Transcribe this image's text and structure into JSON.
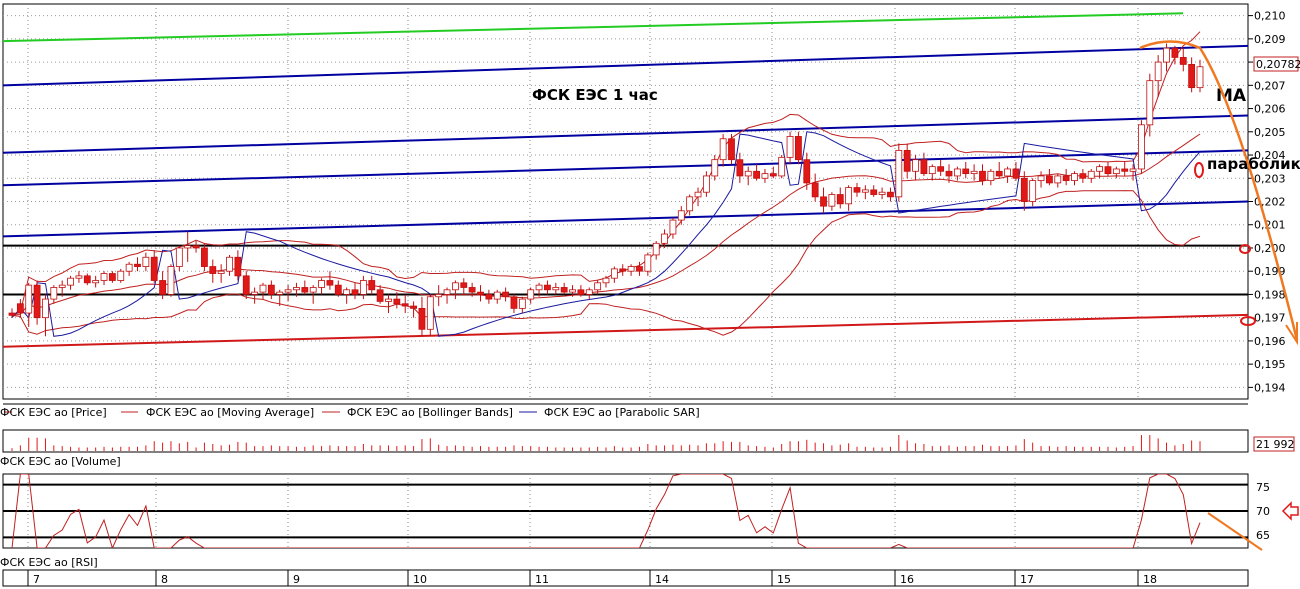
{
  "annotations": {
    "title": "ФСК ЕЭС   1 час",
    "ma": "MA",
    "parabolic": "параболик"
  },
  "price_panel": {
    "legend": [
      {
        "label": "ФСК ЕЭС ао [Price]",
        "color": "#e02020"
      },
      {
        "label": "ФСК ЕЭС ао [Moving Average]",
        "color": "#c02020"
      },
      {
        "label": "ФСК ЕЭС ао [Bollinger Bands]",
        "color": "#c02020"
      },
      {
        "label": "ФСК ЕЭС ао [Parabolic SAR]",
        "color": "#1a1aa0"
      }
    ],
    "yticks": [
      "0,210",
      "0,209",
      "0,208",
      "0,207",
      "0,206",
      "0,205",
      "0,204",
      "0,203",
      "0,202",
      "0,201",
      "0,200",
      "0,199",
      "0,198",
      "0,197",
      "0,196",
      "0,195",
      "0,194"
    ],
    "last_price": "0,20782"
  },
  "volume_panel": {
    "label": "ФСК ЕЭС ао [Volume]",
    "last_value": "21 992"
  },
  "rsi_panel": {
    "label": "ФСК ЕЭС ао [RSI]",
    "yticks": [
      "75",
      "70",
      "65"
    ]
  },
  "xaxis": {
    "labels": [
      "7",
      "8",
      "9",
      "10",
      "11",
      "14",
      "15",
      "16",
      "17",
      "18"
    ]
  },
  "colors": {
    "bullish": "#ffffff",
    "bearish": "#e01818",
    "candle_edge": "#c01010",
    "trend_blue": "#0000a0",
    "trend_green": "#22cc22",
    "trend_red": "#d01818",
    "level_black": "#000000",
    "forecast_orange": "#f07820"
  },
  "chart_data": {
    "type": "candlestick",
    "timeframe": "1h",
    "x_days": [
      "7",
      "8",
      "9",
      "10",
      "11",
      "14",
      "15",
      "16",
      "17",
      "18"
    ],
    "ylim": [
      0.1935,
      0.2105
    ],
    "candles_ohlc": [
      [
        0.1972,
        0.1974,
        0.197,
        0.1971
      ],
      [
        0.1976,
        0.1978,
        0.197,
        0.1972
      ],
      [
        0.1972,
        0.1985,
        0.1966,
        0.1984
      ],
      [
        0.1984,
        0.1986,
        0.1967,
        0.197
      ],
      [
        0.197,
        0.198,
        0.1962,
        0.1978
      ],
      [
        0.1978,
        0.1984,
        0.1976,
        0.1983
      ],
      [
        0.1983,
        0.1986,
        0.1979,
        0.1984
      ],
      [
        0.1984,
        0.1988,
        0.1982,
        0.1987
      ],
      [
        0.1987,
        0.199,
        0.1985,
        0.1988
      ],
      [
        0.1988,
        0.1989,
        0.1984,
        0.1985
      ],
      [
        0.1985,
        0.1988,
        0.1983,
        0.1986
      ],
      [
        0.1986,
        0.199,
        0.1984,
        0.1989
      ],
      [
        0.1989,
        0.199,
        0.1985,
        0.1986
      ],
      [
        0.1986,
        0.1991,
        0.1985,
        0.199
      ],
      [
        0.199,
        0.1994,
        0.1988,
        0.1993
      ],
      [
        0.1993,
        0.1996,
        0.199,
        0.1992
      ],
      [
        0.1992,
        0.1998,
        0.199,
        0.1996
      ],
      [
        0.1996,
        0.1999,
        0.1985,
        0.1986
      ],
      [
        0.1986,
        0.199,
        0.1978,
        0.198
      ],
      [
        0.198,
        0.1993,
        0.1979,
        0.1992
      ],
      [
        0.1992,
        0.2001,
        0.199,
        0.2
      ],
      [
        0.2,
        0.2007,
        0.1994,
        0.2001
      ],
      [
        0.2001,
        0.2003,
        0.1998,
        0.2
      ],
      [
        0.2,
        0.2002,
        0.199,
        0.1992
      ],
      [
        0.1992,
        0.1995,
        0.1985,
        0.1989
      ],
      [
        0.1989,
        0.1993,
        0.1985,
        0.199
      ],
      [
        0.199,
        0.1997,
        0.1988,
        0.1996
      ],
      [
        0.1996,
        0.1999,
        0.1986,
        0.1988
      ],
      [
        0.1988,
        0.199,
        0.1978,
        0.198
      ],
      [
        0.198,
        0.1983,
        0.1976,
        0.1981
      ],
      [
        0.1981,
        0.1985,
        0.1978,
        0.1984
      ],
      [
        0.1984,
        0.1986,
        0.1978,
        0.198
      ],
      [
        0.198,
        0.1982,
        0.1975,
        0.1981
      ],
      [
        0.1981,
        0.1984,
        0.1977,
        0.1982
      ],
      [
        0.1982,
        0.1985,
        0.1979,
        0.1983
      ],
      [
        0.1983,
        0.1986,
        0.198,
        0.1981
      ],
      [
        0.1981,
        0.1984,
        0.1976,
        0.1983
      ],
      [
        0.1983,
        0.1987,
        0.198,
        0.1986
      ],
      [
        0.1986,
        0.199,
        0.1982,
        0.1984
      ],
      [
        0.1984,
        0.1986,
        0.1979,
        0.198
      ],
      [
        0.198,
        0.1983,
        0.1976,
        0.1982
      ],
      [
        0.1982,
        0.1985,
        0.1978,
        0.198
      ],
      [
        0.198,
        0.1988,
        0.1978,
        0.1986
      ],
      [
        0.1986,
        0.1988,
        0.198,
        0.1982
      ],
      [
        0.1982,
        0.1984,
        0.1976,
        0.1977
      ],
      [
        0.1977,
        0.198,
        0.1972,
        0.1978
      ],
      [
        0.1978,
        0.1981,
        0.1974,
        0.1976
      ],
      [
        0.1976,
        0.198,
        0.1972,
        0.1975
      ],
      [
        0.1975,
        0.1977,
        0.197,
        0.1974
      ],
      [
        0.1974,
        0.1979,
        0.1962,
        0.1965
      ],
      [
        0.1965,
        0.198,
        0.1962,
        0.1979
      ],
      [
        0.1979,
        0.1984,
        0.1975,
        0.198
      ],
      [
        0.198,
        0.1983,
        0.1976,
        0.1982
      ],
      [
        0.1982,
        0.1986,
        0.1978,
        0.1985
      ],
      [
        0.1985,
        0.1987,
        0.198,
        0.1983
      ],
      [
        0.1983,
        0.1985,
        0.1979,
        0.1981
      ],
      [
        0.1981,
        0.1984,
        0.1977,
        0.198
      ],
      [
        0.198,
        0.1982,
        0.1976,
        0.1978
      ],
      [
        0.1978,
        0.1982,
        0.1976,
        0.1981
      ],
      [
        0.1981,
        0.1983,
        0.1977,
        0.1979
      ],
      [
        0.1979,
        0.198,
        0.1972,
        0.1974
      ],
      [
        0.1974,
        0.1979,
        0.1972,
        0.1978
      ],
      [
        0.1978,
        0.1983,
        0.1976,
        0.1982
      ],
      [
        0.1982,
        0.1985,
        0.1979,
        0.1984
      ],
      [
        0.1984,
        0.1986,
        0.198,
        0.1982
      ],
      [
        0.1982,
        0.1985,
        0.198,
        0.1983
      ],
      [
        0.1983,
        0.1985,
        0.198,
        0.1981
      ],
      [
        0.1981,
        0.1984,
        0.1979,
        0.1982
      ],
      [
        0.1982,
        0.1984,
        0.1979,
        0.198
      ],
      [
        0.198,
        0.1983,
        0.1978,
        0.1982
      ],
      [
        0.1982,
        0.1986,
        0.198,
        0.1985
      ],
      [
        0.1985,
        0.1988,
        0.1983,
        0.1987
      ],
      [
        0.1987,
        0.1992,
        0.1985,
        0.1991
      ],
      [
        0.1991,
        0.1993,
        0.1988,
        0.199
      ],
      [
        0.199,
        0.1993,
        0.1988,
        0.1992
      ],
      [
        0.1992,
        0.1994,
        0.1988,
        0.199
      ],
      [
        0.199,
        0.1998,
        0.1988,
        0.1997
      ],
      [
        0.1997,
        0.2003,
        0.1995,
        0.2002
      ],
      [
        0.2002,
        0.2008,
        0.2,
        0.2006
      ],
      [
        0.2006,
        0.2013,
        0.2004,
        0.2012
      ],
      [
        0.2012,
        0.2018,
        0.201,
        0.2016
      ],
      [
        0.2016,
        0.2023,
        0.2014,
        0.2022
      ],
      [
        0.2022,
        0.2026,
        0.2018,
        0.2024
      ],
      [
        0.2024,
        0.2033,
        0.2022,
        0.2031
      ],
      [
        0.2031,
        0.204,
        0.2029,
        0.2038
      ],
      [
        0.2038,
        0.2049,
        0.2035,
        0.2047
      ],
      [
        0.2047,
        0.2049,
        0.2036,
        0.2038
      ],
      [
        0.2038,
        0.2041,
        0.2028,
        0.2031
      ],
      [
        0.2031,
        0.2035,
        0.2027,
        0.2033
      ],
      [
        0.2033,
        0.2036,
        0.2029,
        0.203
      ],
      [
        0.203,
        0.2034,
        0.2028,
        0.2032
      ],
      [
        0.2032,
        0.2035,
        0.203,
        0.2031
      ],
      [
        0.2031,
        0.204,
        0.203,
        0.2039
      ],
      [
        0.2039,
        0.205,
        0.2036,
        0.2048
      ],
      [
        0.2048,
        0.205,
        0.2036,
        0.2038
      ],
      [
        0.2038,
        0.2041,
        0.2025,
        0.2028
      ],
      [
        0.2028,
        0.2032,
        0.202,
        0.2022
      ],
      [
        0.2022,
        0.2026,
        0.2015,
        0.2018
      ],
      [
        0.2018,
        0.2024,
        0.2016,
        0.2023
      ],
      [
        0.2023,
        0.2026,
        0.2017,
        0.2019
      ],
      [
        0.2019,
        0.2027,
        0.2016,
        0.2026
      ],
      [
        0.2026,
        0.2028,
        0.2022,
        0.2024
      ],
      [
        0.2024,
        0.2027,
        0.2021,
        0.2025
      ],
      [
        0.2025,
        0.2027,
        0.2022,
        0.2023
      ],
      [
        0.2023,
        0.2026,
        0.2021,
        0.2024
      ],
      [
        0.2024,
        0.2026,
        0.202,
        0.2022
      ],
      [
        0.2022,
        0.2045,
        0.202,
        0.2042
      ],
      [
        0.2042,
        0.2045,
        0.203,
        0.2033
      ],
      [
        0.2033,
        0.204,
        0.2029,
        0.2038
      ],
      [
        0.2038,
        0.2041,
        0.2031,
        0.2032
      ],
      [
        0.2032,
        0.2036,
        0.2029,
        0.2035
      ],
      [
        0.2035,
        0.2038,
        0.2031,
        0.2033
      ],
      [
        0.2033,
        0.2036,
        0.2028,
        0.2031
      ],
      [
        0.2031,
        0.2035,
        0.2029,
        0.2034
      ],
      [
        0.2034,
        0.2037,
        0.203,
        0.2032
      ],
      [
        0.2032,
        0.2036,
        0.2029,
        0.2033
      ],
      [
        0.2033,
        0.2036,
        0.2027,
        0.2029
      ],
      [
        0.2029,
        0.2034,
        0.2027,
        0.2033
      ],
      [
        0.2033,
        0.2037,
        0.203,
        0.2031
      ],
      [
        0.2031,
        0.2035,
        0.2028,
        0.2034
      ],
      [
        0.2034,
        0.2037,
        0.2029,
        0.203
      ],
      [
        0.203,
        0.2033,
        0.2016,
        0.202
      ],
      [
        0.202,
        0.203,
        0.2018,
        0.2029
      ],
      [
        0.2029,
        0.2033,
        0.2026,
        0.2031
      ],
      [
        0.2031,
        0.2034,
        0.2027,
        0.2028
      ],
      [
        0.2028,
        0.2032,
        0.2026,
        0.2031
      ],
      [
        0.2031,
        0.2034,
        0.2027,
        0.2029
      ],
      [
        0.2029,
        0.2033,
        0.2027,
        0.2032
      ],
      [
        0.2032,
        0.2034,
        0.2028,
        0.203
      ],
      [
        0.203,
        0.2034,
        0.2028,
        0.2033
      ],
      [
        0.2033,
        0.2036,
        0.203,
        0.2035
      ],
      [
        0.2035,
        0.2037,
        0.2031,
        0.2032
      ],
      [
        0.2032,
        0.2035,
        0.203,
        0.2034
      ],
      [
        0.2034,
        0.2037,
        0.2031,
        0.2033
      ],
      [
        0.2033,
        0.2036,
        0.2029,
        0.2034
      ],
      [
        0.2034,
        0.2055,
        0.2032,
        0.2053
      ],
      [
        0.2053,
        0.2075,
        0.2048,
        0.2072
      ],
      [
        0.2072,
        0.2083,
        0.2065,
        0.208
      ],
      [
        0.208,
        0.2088,
        0.2076,
        0.2086
      ],
      [
        0.2086,
        0.2087,
        0.2079,
        0.2082
      ],
      [
        0.2082,
        0.2086,
        0.2076,
        0.2079
      ],
      [
        0.2079,
        0.2082,
        0.2067,
        0.2069
      ],
      [
        0.2069,
        0.2081,
        0.2067,
        0.2078
      ]
    ],
    "trend_lines": [
      {
        "color": "green",
        "start": 0.2089,
        "end": 0.2101
      },
      {
        "color": "blue",
        "start": 0.207,
        "end": 0.2087
      },
      {
        "color": "blue",
        "start": 0.2041,
        "end": 0.2057
      },
      {
        "color": "blue",
        "start": 0.2027,
        "end": 0.2042
      },
      {
        "color": "blue",
        "start": 0.2005,
        "end": 0.202
      },
      {
        "color": "red",
        "start": 0.19575,
        "end": 0.19712
      }
    ],
    "horizontal_levels": [
      0.2001,
      0.198
    ],
    "rsi": {
      "levels": [
        75,
        70,
        65
      ],
      "ylim": [
        63,
        77
      ]
    }
  }
}
